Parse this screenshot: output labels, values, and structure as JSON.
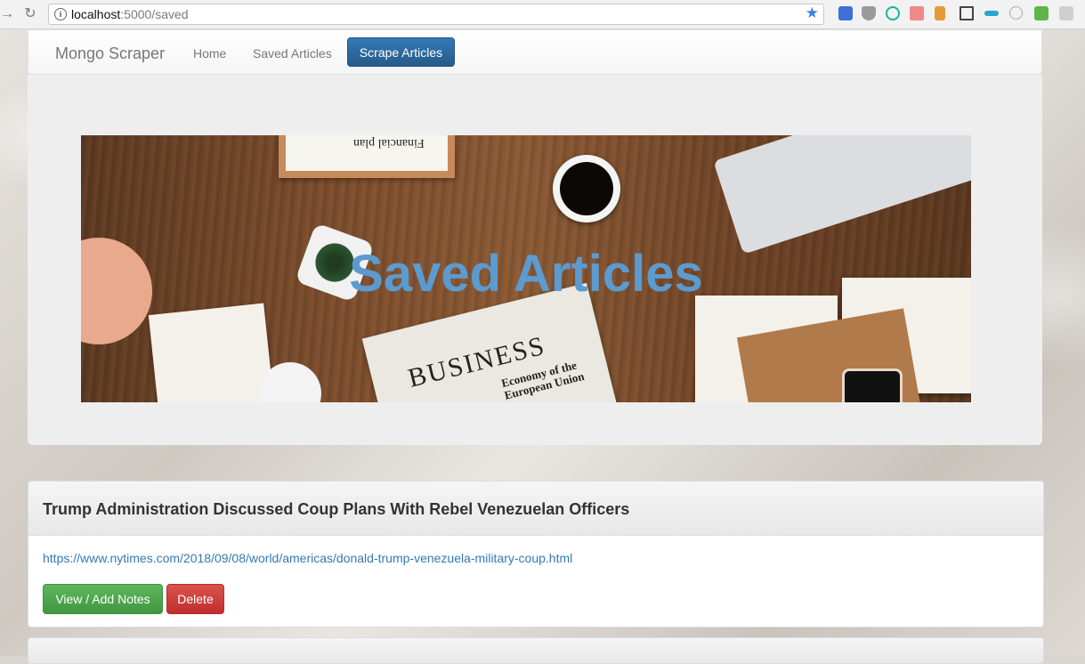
{
  "browser": {
    "url_host": "localhost",
    "url_path": ":5000/saved"
  },
  "navbar": {
    "brand": "Mongo Scraper",
    "links": [
      "Home",
      "Saved Articles"
    ],
    "primary_button": "Scrape Articles"
  },
  "jumbotron": {
    "title": "Saved Articles",
    "image_texts": {
      "clipboard": "Financial plan",
      "newspaper_header": "BUSINESS",
      "newspaper_headline": "Economy of the European Union"
    }
  },
  "articles": [
    {
      "title": "Trump Administration Discussed Coup Plans With Rebel Venezuelan Officers",
      "link": "https://www.nytimes.com/2018/09/08/world/americas/donald-trump-venezuela-military-coup.html",
      "notes_button": "View / Add Notes",
      "delete_button": "Delete"
    }
  ],
  "colors": {
    "primary": "#337ab7",
    "success": "#5cb85c",
    "danger": "#d9534f",
    "hero_title": "#5b9bd0"
  }
}
